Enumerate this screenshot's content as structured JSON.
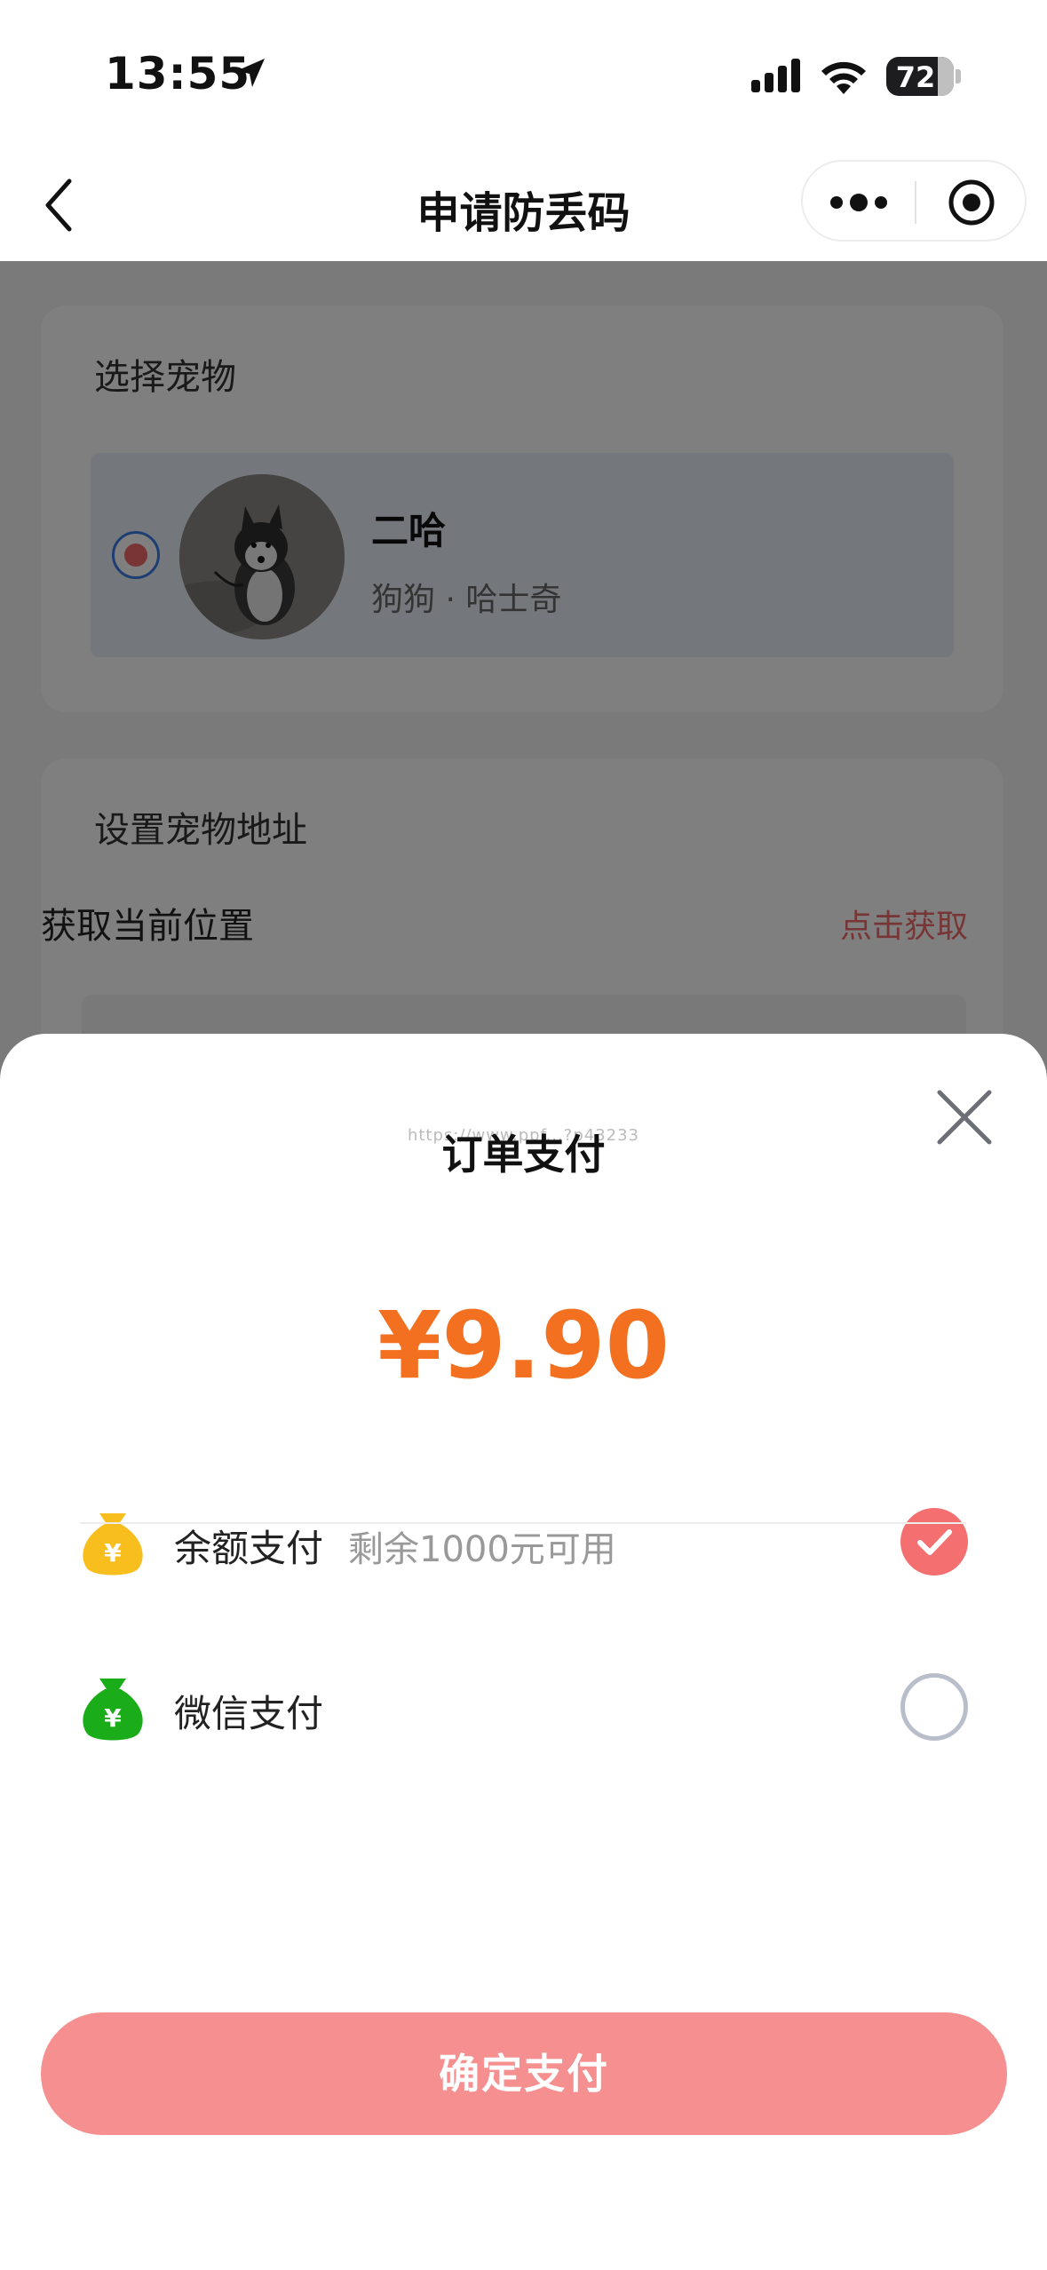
{
  "status_bar": {
    "time": "13:55",
    "battery": "72"
  },
  "navbar": {
    "title": "申请防丢码"
  },
  "pet_card": {
    "title": "选择宠物",
    "pet": {
      "name": "二哈",
      "breed": "狗狗 · 哈士奇",
      "selected": true
    }
  },
  "address_card": {
    "title": "设置宠物地址",
    "location_label": "获取当前位置",
    "location_action": "点击获取"
  },
  "payment_sheet": {
    "title": "订单支付",
    "watermark": "https://www.ppf...?p43233",
    "amount": "¥9.90",
    "options": [
      {
        "label": "余额支付",
        "sub": "剩余1000元可用",
        "icon": "money-bag-yellow-icon",
        "selected": true
      },
      {
        "label": "微信支付",
        "sub": "",
        "icon": "money-bag-green-icon",
        "selected": false
      }
    ],
    "confirm_label": "确定支付"
  },
  "colors": {
    "accent": "#f2701f",
    "confirm": "#f69090",
    "check": "#f46f6f",
    "link": "#f06a6a",
    "radio_ring": "#3c7de6",
    "balance_bag": "#f7be1d",
    "wechat_bag": "#1aad19"
  }
}
